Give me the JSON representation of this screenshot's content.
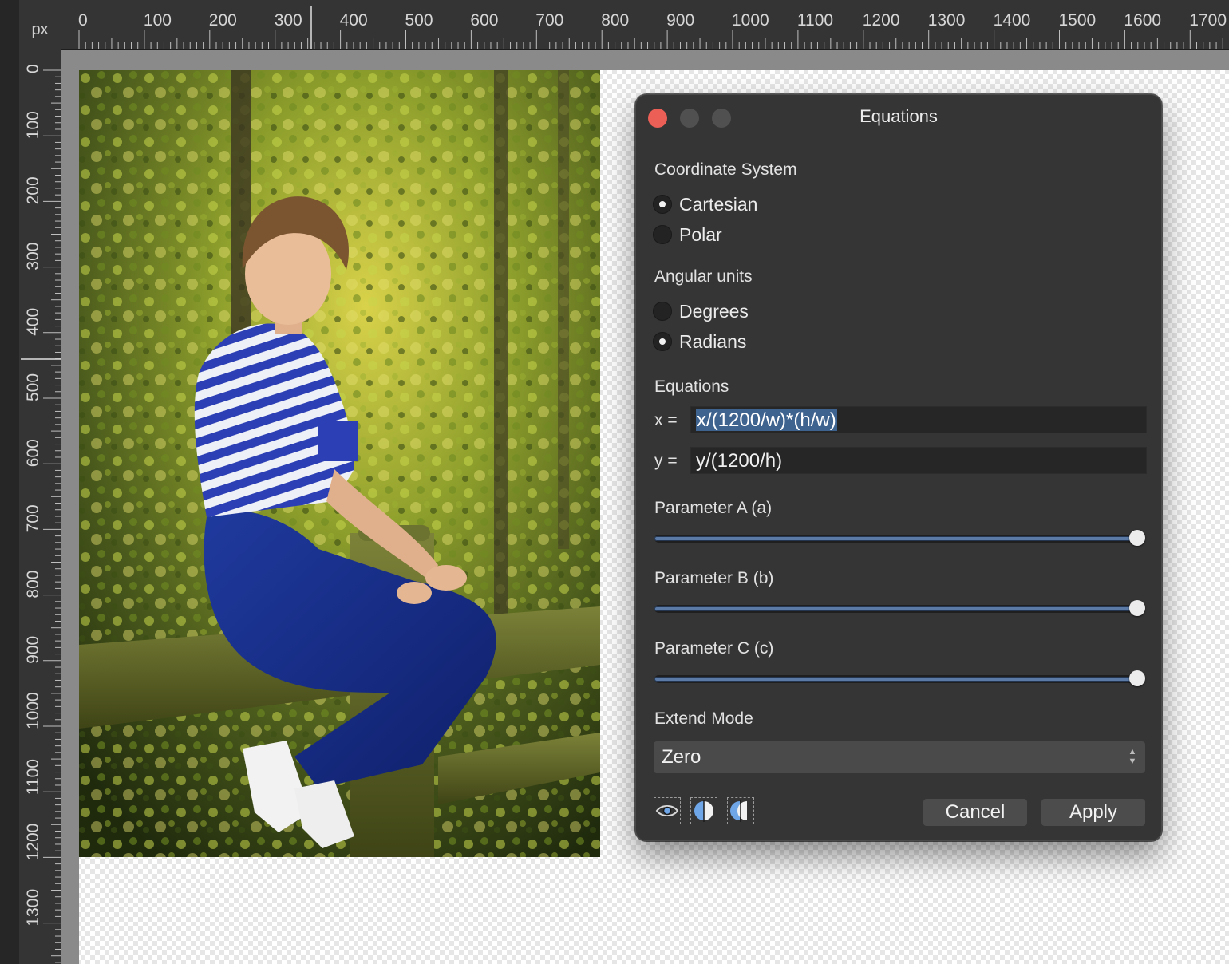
{
  "ruler": {
    "unit": "px",
    "top_labels": [
      "0",
      "100",
      "200",
      "300",
      "400",
      "500",
      "600",
      "700",
      "800",
      "900",
      "1000",
      "1100",
      "1200",
      "1300",
      "1400",
      "1500",
      "1600",
      "1700"
    ],
    "left_labels": [
      "0",
      "100",
      "200",
      "300",
      "400",
      "500",
      "600",
      "700",
      "800",
      "900",
      "1000",
      "1100",
      "1200",
      "1300"
    ]
  },
  "dialog": {
    "title": "Equations",
    "coordinate_system": {
      "label": "Coordinate System",
      "options": [
        {
          "label": "Cartesian",
          "selected": true
        },
        {
          "label": "Polar",
          "selected": false
        }
      ]
    },
    "angular_units": {
      "label": "Angular units",
      "options": [
        {
          "label": "Degrees",
          "selected": false
        },
        {
          "label": "Radians",
          "selected": true
        }
      ]
    },
    "equations": {
      "label": "Equations",
      "x_prefix": "x =",
      "x_value": "x/(1200/w)*(h/w)",
      "y_prefix": "y =",
      "y_value": "y/(1200/h)"
    },
    "parameters": [
      {
        "label": "Parameter A (a)",
        "value": 1.0
      },
      {
        "label": "Parameter B (b)",
        "value": 1.0
      },
      {
        "label": "Parameter C (c)",
        "value": 1.0
      }
    ],
    "extend_mode": {
      "label": "Extend Mode",
      "value": "Zero"
    },
    "buttons": {
      "cancel": "Cancel",
      "apply": "Apply"
    },
    "icons": [
      "eye-icon",
      "split-view-icon",
      "mirror-split-icon"
    ],
    "colors": {
      "close": "#ec5f57",
      "slider_fill": "#5b7ba6",
      "selection": "#3f638f"
    }
  }
}
